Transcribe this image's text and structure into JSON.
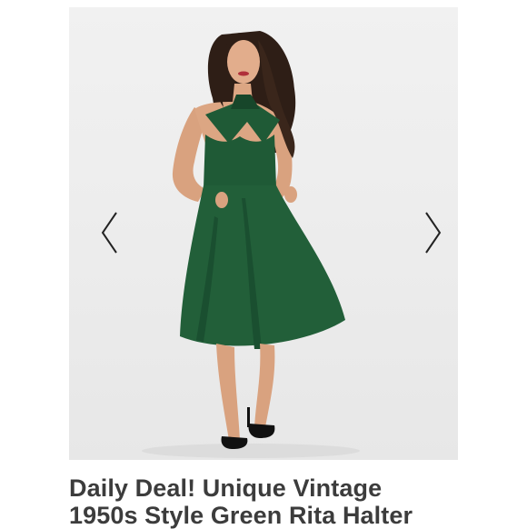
{
  "listing": {
    "image": {
      "subject": "model wearing green halter swing dress",
      "dress_color": "#1f5a36",
      "background_color": "#ececec"
    },
    "carousel": {
      "prev_icon": "chevron-left-icon",
      "next_icon": "chevron-right-icon"
    },
    "title_line1": "Daily Deal! Unique Vintage",
    "title_line2": "1950s Style Green Rita Halter"
  }
}
